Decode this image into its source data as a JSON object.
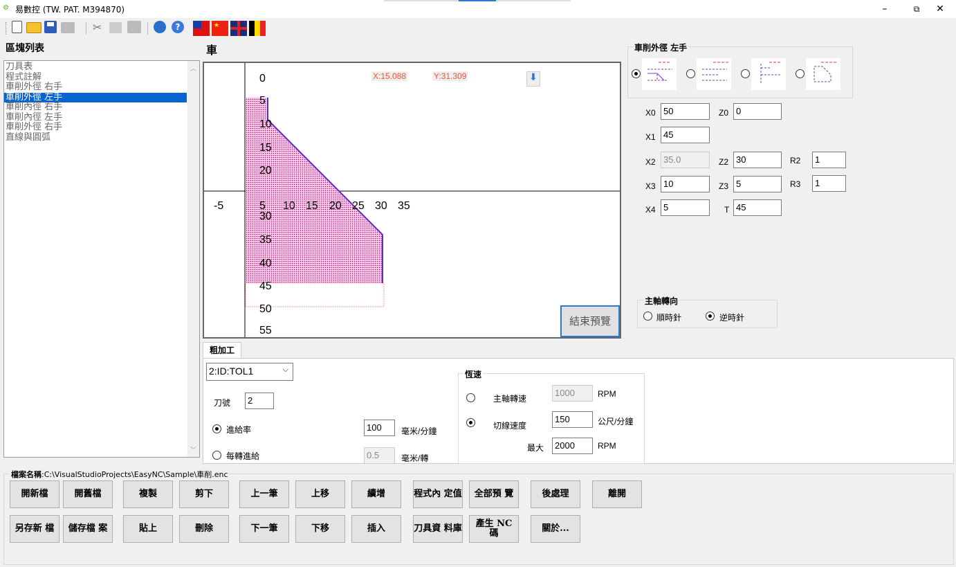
{
  "window": {
    "title": "易數控 (TW. PAT. M394870)",
    "minimize": "–",
    "restore": "⧉",
    "close": "✕"
  },
  "toolbar": {
    "icons": [
      "new-icon",
      "open-icon",
      "save-icon",
      "print-icon",
      "cut-icon",
      "copy-icon",
      "paste-icon",
      "settings-icon",
      "help-icon"
    ],
    "flags": [
      "taiwan",
      "china",
      "uk",
      "belgium"
    ]
  },
  "sidebar": {
    "title": "區塊列表",
    "items": [
      "刀具表",
      "程式註解",
      "車削外徑 右手",
      "車削外徑 左手",
      "車削內徑 右手",
      "車削內徑 左手",
      "車削外徑 右手",
      "直線與圓弧"
    ],
    "selected_index": 3
  },
  "preview": {
    "title": "車",
    "x_readout": "X:15.088",
    "y_readout": "Y:31.309",
    "x_ticks": [
      "-5",
      "5",
      "10",
      "15",
      "20",
      "25",
      "30",
      "35"
    ],
    "y_ticks": [
      "0",
      "5",
      "10",
      "15",
      "20",
      "30",
      "35",
      "40",
      "45",
      "50",
      "55"
    ],
    "end_preview_button": "結束預覽"
  },
  "params": {
    "group_title": "車削外徑 左手",
    "fields": {
      "X0": "50",
      "Z0": "0",
      "X1": "45",
      "X2": "35.0",
      "Z2": "30",
      "R2": "1",
      "X3": "10",
      "Z3": "5",
      "R3": "1",
      "X4": "5",
      "T": "45"
    },
    "labels": {
      "X0": "X0",
      "Z0": "Z0",
      "X1": "X1",
      "X2": "X2",
      "Z2": "Z2",
      "R2": "R2",
      "X3": "X3",
      "Z3": "Z3",
      "R3": "R3",
      "X4": "X4",
      "T": "T"
    },
    "spindle_title": "主軸轉向",
    "spindle_cw": "順時針",
    "spindle_ccw": "逆時針"
  },
  "roughing": {
    "tab": "粗加工",
    "tool_select": "2:ID:TOL1",
    "tool_no_label": "刀號",
    "tool_no": "2",
    "feed_rate_label": "進給率",
    "feed_rate": "100",
    "feed_rate_unit": "毫米/分鐘",
    "feed_per_rev_label": "每轉進給",
    "feed_per_rev": "0.5",
    "feed_per_rev_unit": "毫米/轉",
    "speed_group": "恆速",
    "spindle_speed_label": "主軸轉速",
    "spindle_speed": "1000",
    "rpm": "RPM",
    "cut_speed_label": "切線速度",
    "cut_speed": "150",
    "cut_speed_unit": "公尺/分鐘",
    "max_label": "最大",
    "max_rpm": "2000",
    "rpm2": "RPM"
  },
  "file": {
    "label": "檔案名稱",
    "path": ":C:\\VisualStudioProjects\\EasyNC\\Sample\\車削.enc"
  },
  "buttons": {
    "new_file": "開新檔",
    "open_file": "開舊檔",
    "copy": "複製",
    "cut": "剪下",
    "prev": "上一筆",
    "move_up": "上移",
    "add": "續增",
    "program_value": "程式內 定值",
    "preview_all": "全部預 覽",
    "post_process": "後處理",
    "exit": "離開",
    "save_as": "另存新 檔",
    "save": "儲存檔 案",
    "paste": "貼上",
    "delete": "刪除",
    "next": "下一筆",
    "move_down": "下移",
    "insert": "插入",
    "tool_db": "刀具資 料庫",
    "gen_nc": "產生 NC 碼",
    "about": "關於..."
  }
}
